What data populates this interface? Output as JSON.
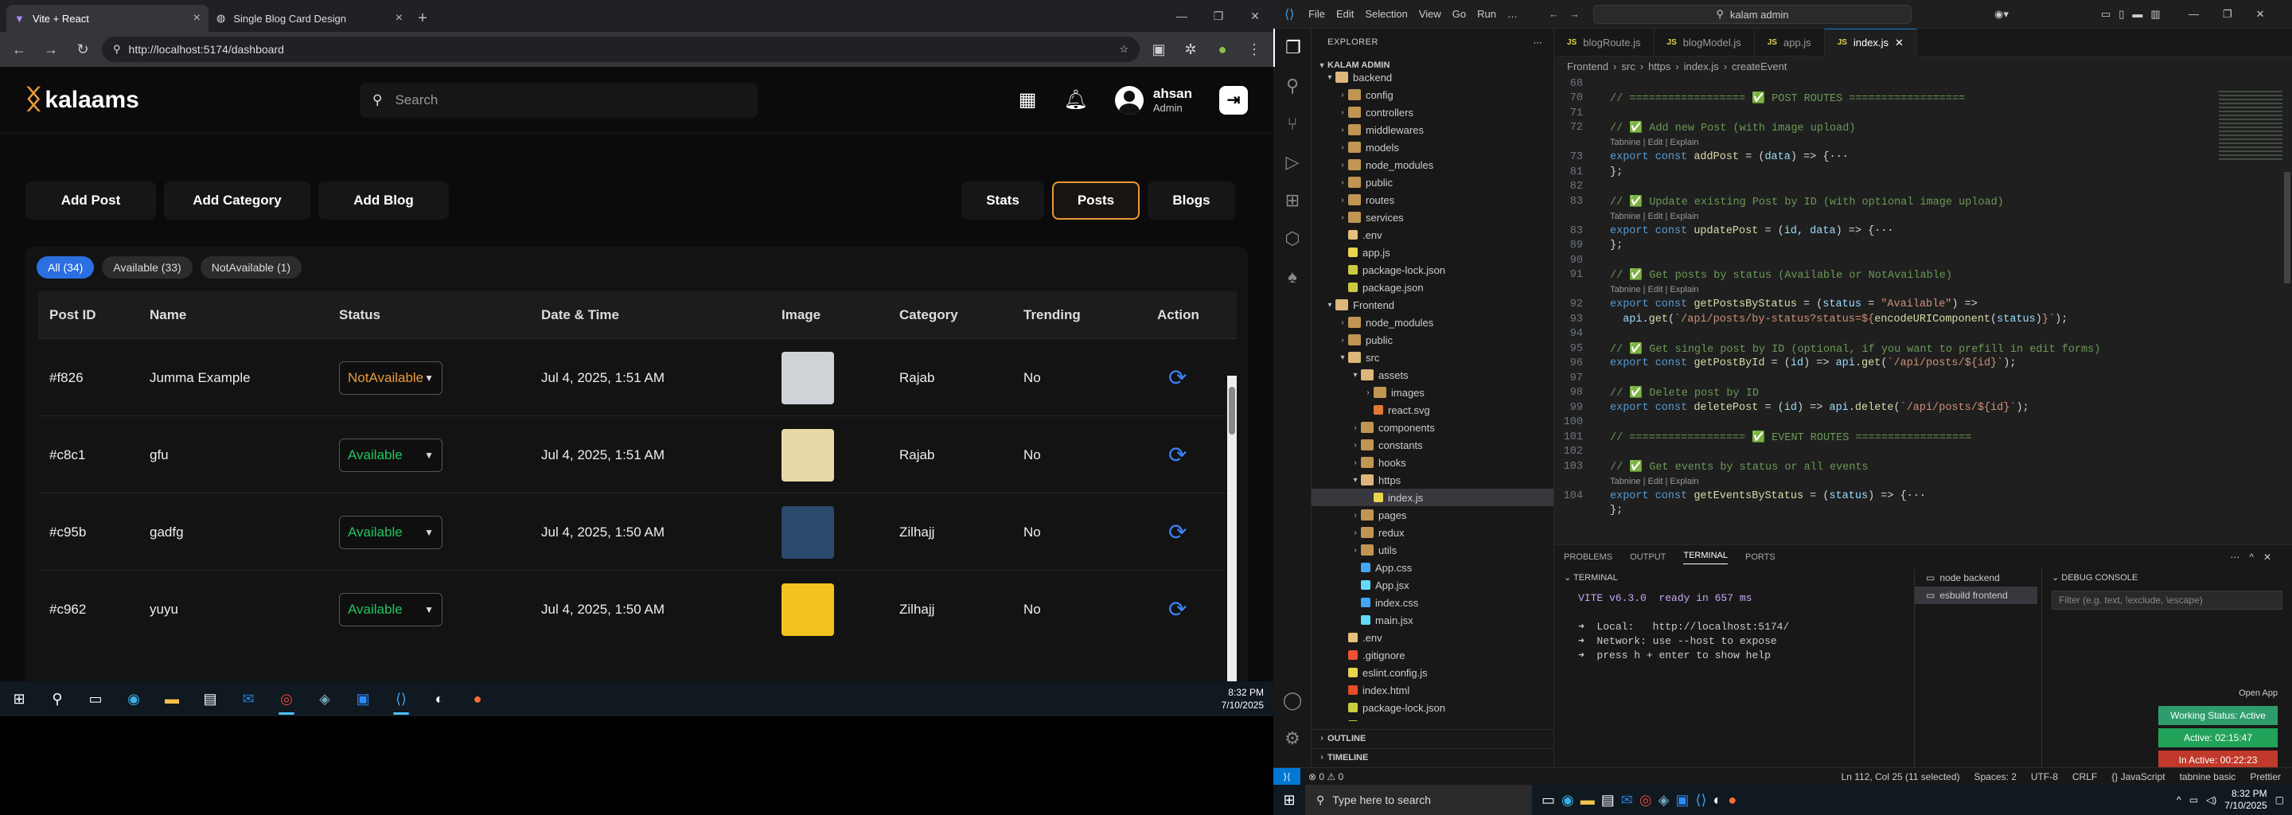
{
  "browser": {
    "tabs": [
      {
        "title": "Vite + React",
        "active": true
      },
      {
        "title": "Single Blog Card Design",
        "active": false
      }
    ],
    "url": "http://localhost:5174/dashboard"
  },
  "app": {
    "logo_text": "kalaams",
    "search_placeholder": "Search",
    "user": {
      "name": "ahsan",
      "role": "Admin"
    },
    "left_actions": [
      "Add Post",
      "Add Category",
      "Add Blog"
    ],
    "right_actions": [
      "Stats",
      "Posts",
      "Blogs"
    ],
    "selected_action": "Posts",
    "filters": [
      {
        "label": "All (34)",
        "selected": true
      },
      {
        "label": "Available (33)",
        "selected": false
      },
      {
        "label": "NotAvailable (1)",
        "selected": false
      }
    ],
    "columns": [
      "Post ID",
      "Name",
      "Status",
      "Date & Time",
      "Image",
      "Category",
      "Trending",
      "Action"
    ],
    "rows": [
      {
        "id": "#f826",
        "name": "Jumma Example",
        "status": "NotAvailable",
        "status_color": "#e89a3c",
        "date": "Jul 4, 2025, 1:51 AM",
        "image_color": "#cfd3d8",
        "category": "Rajab",
        "trending": "No"
      },
      {
        "id": "#c8c1",
        "name": "gfu",
        "status": "Available",
        "status_color": "#22c55e",
        "date": "Jul 4, 2025, 1:51 AM",
        "image_color": "#e7d9a8",
        "category": "Rajab",
        "trending": "No"
      },
      {
        "id": "#c95b",
        "name": "gadfg",
        "status": "Available",
        "status_color": "#22c55e",
        "date": "Jul 4, 2025, 1:50 AM",
        "image_color": "#2a4a6e",
        "category": "Zilhajj",
        "trending": "No"
      },
      {
        "id": "#c962",
        "name": "yuyu",
        "status": "Available",
        "status_color": "#22c55e",
        "date": "Jul 4, 2025, 1:50 AM",
        "image_color": "#f4c21e",
        "category": "Zilhajj",
        "trending": "No"
      }
    ]
  },
  "taskbar_left": {
    "time": "8:32 PM",
    "date": "7/10/2025"
  },
  "vscode": {
    "menu": [
      "File",
      "Edit",
      "Selection",
      "View",
      "Go",
      "Run",
      "…"
    ],
    "command_center": "kalam admin",
    "explorer_title": "EXPLORER",
    "workspace": "KALAM ADMIN",
    "tree": [
      {
        "name": "backend",
        "depth": 1,
        "kind": "folder-open"
      },
      {
        "name": "config",
        "depth": 2,
        "kind": "folder"
      },
      {
        "name": "controllers",
        "depth": 2,
        "kind": "folder"
      },
      {
        "name": "middlewares",
        "depth": 2,
        "kind": "folder"
      },
      {
        "name": "models",
        "depth": 2,
        "kind": "folder"
      },
      {
        "name": "node_modules",
        "depth": 2,
        "kind": "folder"
      },
      {
        "name": "public",
        "depth": 2,
        "kind": "folder"
      },
      {
        "name": "routes",
        "depth": 2,
        "kind": "folder"
      },
      {
        "name": "services",
        "depth": 2,
        "kind": "folder"
      },
      {
        "name": ".env",
        "depth": 2,
        "kind": "env"
      },
      {
        "name": "app.js",
        "depth": 2,
        "kind": "js"
      },
      {
        "name": "package-lock.json",
        "depth": 2,
        "kind": "json"
      },
      {
        "name": "package.json",
        "depth": 2,
        "kind": "json"
      },
      {
        "name": "Frontend",
        "depth": 1,
        "kind": "folder-open"
      },
      {
        "name": "node_modules",
        "depth": 2,
        "kind": "folder"
      },
      {
        "name": "public",
        "depth": 2,
        "kind": "folder"
      },
      {
        "name": "src",
        "depth": 2,
        "kind": "folder-open"
      },
      {
        "name": "assets",
        "depth": 3,
        "kind": "folder-open"
      },
      {
        "name": "images",
        "depth": 4,
        "kind": "folder"
      },
      {
        "name": "react.svg",
        "depth": 4,
        "kind": "svg"
      },
      {
        "name": "components",
        "depth": 3,
        "kind": "folder"
      },
      {
        "name": "constants",
        "depth": 3,
        "kind": "folder"
      },
      {
        "name": "hooks",
        "depth": 3,
        "kind": "folder"
      },
      {
        "name": "https",
        "depth": 3,
        "kind": "folder-open"
      },
      {
        "name": "index.js",
        "depth": 4,
        "kind": "js",
        "selected": true
      },
      {
        "name": "pages",
        "depth": 3,
        "kind": "folder"
      },
      {
        "name": "redux",
        "depth": 3,
        "kind": "folder"
      },
      {
        "name": "utils",
        "depth": 3,
        "kind": "folder"
      },
      {
        "name": "App.css",
        "depth": 3,
        "kind": "css"
      },
      {
        "name": "App.jsx",
        "depth": 3,
        "kind": "jsx"
      },
      {
        "name": "index.css",
        "depth": 3,
        "kind": "css"
      },
      {
        "name": "main.jsx",
        "depth": 3,
        "kind": "jsx"
      },
      {
        "name": ".env",
        "depth": 2,
        "kind": "env"
      },
      {
        "name": ".gitignore",
        "depth": 2,
        "kind": "git"
      },
      {
        "name": "eslint.config.js",
        "depth": 2,
        "kind": "js"
      },
      {
        "name": "index.html",
        "depth": 2,
        "kind": "html"
      },
      {
        "name": "package-lock.json",
        "depth": 2,
        "kind": "json"
      },
      {
        "name": "package.json",
        "depth": 2,
        "kind": "json"
      }
    ],
    "outline_label": "OUTLINE",
    "timeline_label": "TIMELINE",
    "editor_tabs": [
      {
        "name": "blogRoute.js",
        "active": false
      },
      {
        "name": "blogModel.js",
        "active": false
      },
      {
        "name": "app.js",
        "active": false
      },
      {
        "name": "index.js",
        "active": true
      }
    ],
    "breadcrumbs": [
      "Frontend",
      "src",
      "https",
      "index.js",
      "createEvent"
    ],
    "code_lines": [
      {
        "n": "68",
        "segs": []
      },
      {
        "n": "70",
        "segs": [
          [
            "c-cm",
            "// ================== ✅ POST ROUTES =================="
          ]
        ]
      },
      {
        "n": "71",
        "segs": []
      },
      {
        "n": "72",
        "segs": [
          [
            "c-cm",
            "// ✅ Add new Post (with image upload)"
          ]
        ]
      },
      {
        "n": "",
        "lens": "Tabnine | Edit | Explain"
      },
      {
        "n": "73",
        "segs": [
          [
            "c-kw",
            "export const "
          ],
          [
            "c-fn",
            "addPost"
          ],
          [
            "c-pu",
            " = ("
          ],
          [
            "c-id",
            "data"
          ],
          [
            "c-pu",
            ") => {···"
          ]
        ]
      },
      {
        "n": "81",
        "segs": [
          [
            "c-pu",
            "};"
          ]
        ]
      },
      {
        "n": "82",
        "segs": []
      },
      {
        "n": "83",
        "segs": [
          [
            "c-cm",
            "// ✅ Update existing Post by ID (with optional image upload)"
          ]
        ]
      },
      {
        "n": "",
        "lens": "Tabnine | Edit | Explain"
      },
      {
        "n": "83",
        "segs": [
          [
            "c-kw",
            "export const "
          ],
          [
            "c-fn",
            "updatePost"
          ],
          [
            "c-pu",
            " = ("
          ],
          [
            "c-id",
            "id, data"
          ],
          [
            "c-pu",
            ") => {···"
          ]
        ]
      },
      {
        "n": "89",
        "segs": [
          [
            "c-pu",
            "};"
          ]
        ]
      },
      {
        "n": "90",
        "segs": []
      },
      {
        "n": "91",
        "segs": [
          [
            "c-cm",
            "// ✅ Get posts by status (Available or NotAvailable)"
          ]
        ]
      },
      {
        "n": "",
        "lens": "Tabnine | Edit | Explain"
      },
      {
        "n": "92",
        "segs": [
          [
            "c-kw",
            "export const "
          ],
          [
            "c-fn",
            "getPostsByStatus"
          ],
          [
            "c-pu",
            " = ("
          ],
          [
            "c-id",
            "status"
          ],
          [
            "c-pu",
            " = "
          ],
          [
            "c-st",
            "\"Available\""
          ],
          [
            "c-pu",
            ") =>"
          ]
        ]
      },
      {
        "n": "93",
        "segs": [
          [
            "c-pu",
            "  "
          ],
          [
            "c-id",
            "api"
          ],
          [
            "c-pu",
            "."
          ],
          [
            "c-fn",
            "get"
          ],
          [
            "c-pu",
            "("
          ],
          [
            "c-st",
            "`/api/posts/by-status?status=${"
          ],
          [
            "c-fn",
            "encodeURIComponent"
          ],
          [
            "c-pu",
            "("
          ],
          [
            "c-id",
            "status"
          ],
          [
            "c-pu",
            ")"
          ],
          [
            "c-st",
            "}`"
          ],
          [
            "c-pu",
            ");"
          ]
        ]
      },
      {
        "n": "94",
        "segs": []
      },
      {
        "n": "95",
        "segs": [
          [
            "c-cm",
            "// ✅ Get single post by ID (optional, if you want to prefill in edit forms)"
          ]
        ]
      },
      {
        "n": "96",
        "segs": [
          [
            "c-kw",
            "export const "
          ],
          [
            "c-fn",
            "getPostById"
          ],
          [
            "c-pu",
            " = ("
          ],
          [
            "c-id",
            "id"
          ],
          [
            "c-pu",
            ") => "
          ],
          [
            "c-id",
            "api"
          ],
          [
            "c-pu",
            "."
          ],
          [
            "c-fn",
            "get"
          ],
          [
            "c-pu",
            "("
          ],
          [
            "c-st",
            "`/api/posts/${id}`"
          ],
          [
            "c-pu",
            ");"
          ]
        ]
      },
      {
        "n": "97",
        "segs": []
      },
      {
        "n": "98",
        "segs": [
          [
            "c-cm",
            "// ✅ Delete post by ID"
          ]
        ]
      },
      {
        "n": "99",
        "segs": [
          [
            "c-kw",
            "export const "
          ],
          [
            "c-fn",
            "deletePost"
          ],
          [
            "c-pu",
            " = ("
          ],
          [
            "c-id",
            "id"
          ],
          [
            "c-pu",
            ") => "
          ],
          [
            "c-id",
            "api"
          ],
          [
            "c-pu",
            "."
          ],
          [
            "c-fn",
            "delete"
          ],
          [
            "c-pu",
            "("
          ],
          [
            "c-st",
            "`/api/posts/${id}`"
          ],
          [
            "c-pu",
            ");"
          ]
        ]
      },
      {
        "n": "100",
        "segs": []
      },
      {
        "n": "101",
        "segs": [
          [
            "c-cm",
            "// ================== ✅ EVENT ROUTES =================="
          ]
        ]
      },
      {
        "n": "102",
        "segs": []
      },
      {
        "n": "103",
        "segs": [
          [
            "c-cm",
            "// ✅ Get events by status or all events"
          ]
        ]
      },
      {
        "n": "",
        "lens": "Tabnine | Edit | Explain"
      },
      {
        "n": "104",
        "segs": [
          [
            "c-kw",
            "export const "
          ],
          [
            "c-fn",
            "getEventsByStatus"
          ],
          [
            "c-pu",
            " = ("
          ],
          [
            "c-id",
            "status"
          ],
          [
            "c-pu",
            ") => {···"
          ]
        ]
      },
      {
        "n": "",
        "segs": [
          [
            "c-pu",
            "};"
          ]
        ]
      }
    ],
    "panel_tabs": [
      "PROBLEMS",
      "OUTPUT",
      "TERMINAL",
      "PORTS"
    ],
    "panel_active": "TERMINAL",
    "terminal_title": "TERMINAL",
    "terminal_lines": [
      "VITE v6.3.0  ready in 657 ms",
      "",
      "➜  Local:   http://localhost:5174/",
      "➜  Network: use --host to expose",
      "➜  press h + enter to show help"
    ],
    "terminal_list": [
      "node  backend",
      "esbuild  frontend"
    ],
    "debug_title": "DEBUG CONSOLE",
    "debug_placeholder": "Filter (e.g. text, !exclude, \\escape)",
    "open_app": "Open App",
    "badges": [
      {
        "text": "Working Status: Active",
        "color": "#2e9d6b"
      },
      {
        "text": "Active: 02:15:47",
        "color": "#22a35a"
      },
      {
        "text": "In Active: 00:22:23",
        "color": "#c0392b"
      }
    ],
    "status_left": "⊗ 0 ⚠ 0",
    "status_right": [
      "Ln 112, Col 25 (11 selected)",
      "Spaces: 2",
      "UTF-8",
      "CRLF",
      "{} JavaScript",
      "tabnine basic",
      "Prettier"
    ]
  },
  "win_taskbar": {
    "search": "Type here to search",
    "time": "8:32 PM",
    "date": "7/10/2025"
  }
}
